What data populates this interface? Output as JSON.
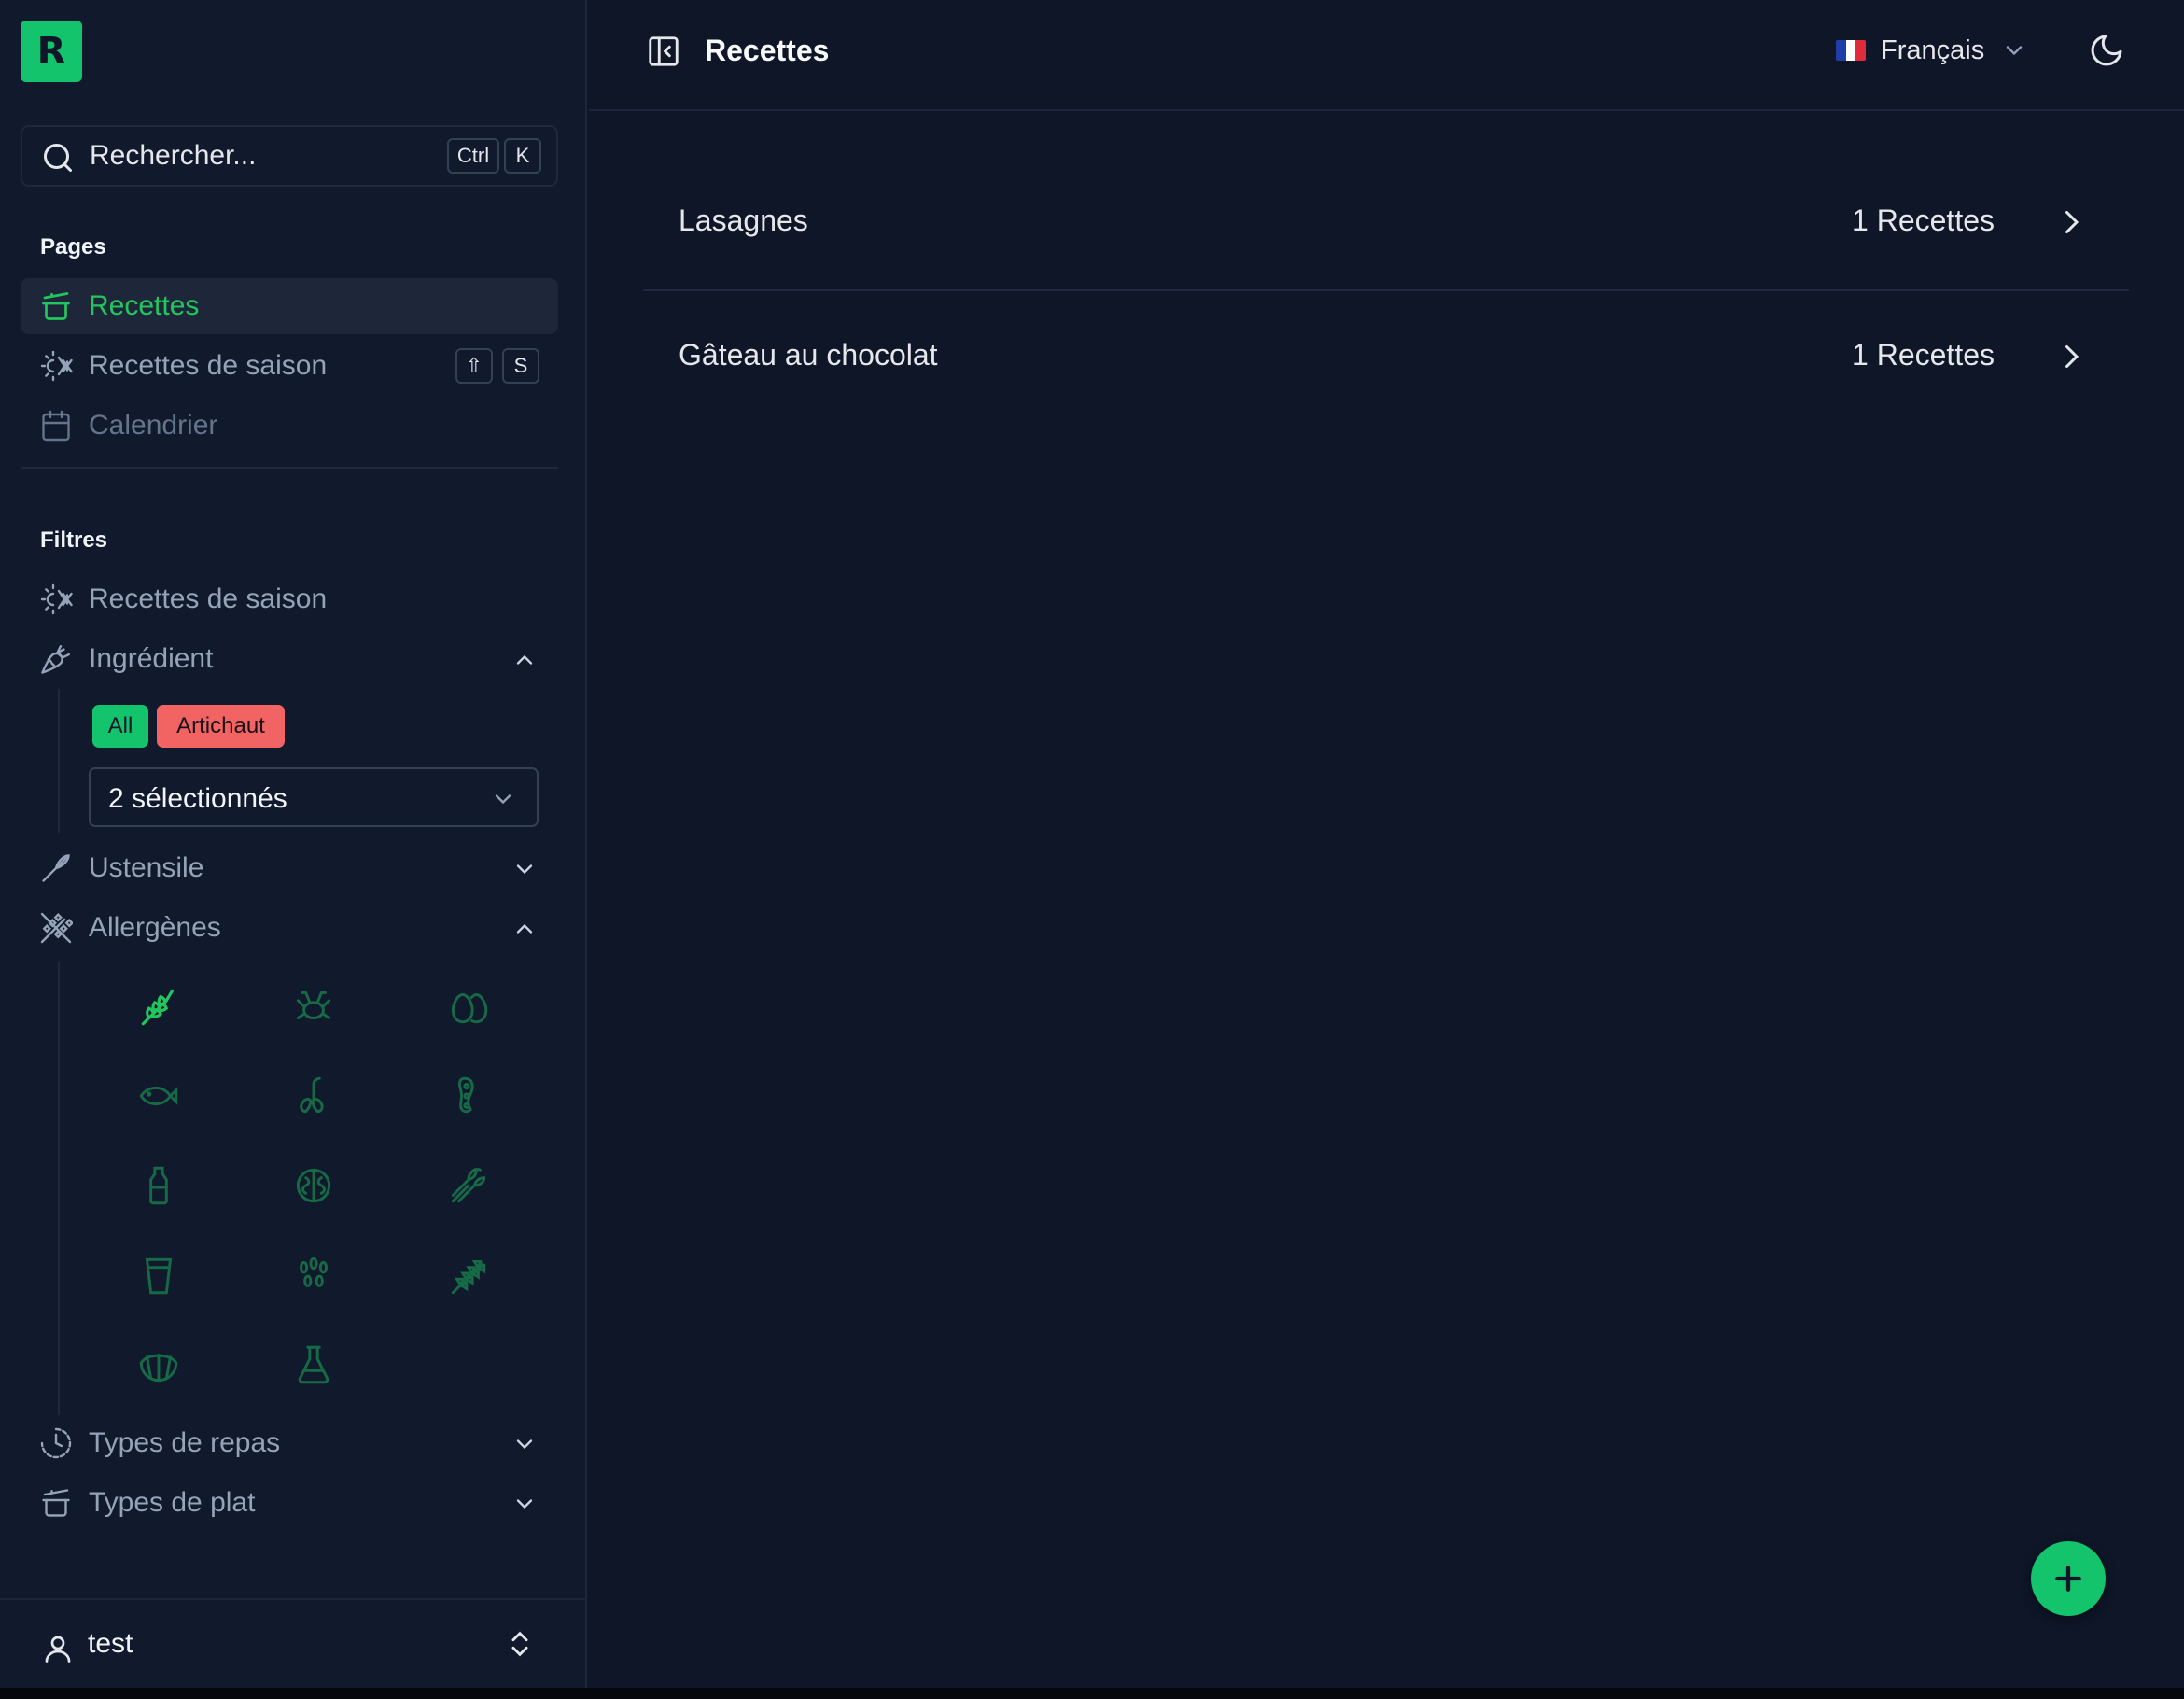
{
  "app": {
    "logo_letter": "R"
  },
  "search": {
    "placeholder": "Rechercher...",
    "shortcut": [
      "Ctrl",
      "K"
    ]
  },
  "sidebar": {
    "pages_title": "Pages",
    "pages": [
      {
        "label": "Recettes",
        "icon": "pot-icon",
        "active": true
      },
      {
        "label": "Recettes de saison",
        "icon": "sun-snowflake-icon",
        "shortcut": [
          "⇧",
          "S"
        ]
      },
      {
        "label": "Calendrier",
        "icon": "calendar-icon"
      }
    ],
    "filters_title": "Filtres",
    "filters": {
      "season": {
        "label": "Recettes de saison",
        "icon": "sun-snowflake-icon"
      },
      "ingredient": {
        "label": "Ingrédient",
        "icon": "carrot-icon",
        "expanded": true,
        "chips": [
          {
            "label": "All",
            "color": "#14c46c"
          },
          {
            "label": "Artichaut",
            "color": "#f26464"
          }
        ],
        "select_value": "2 sélectionnés"
      },
      "utensil": {
        "label": "Ustensile",
        "icon": "whisk-icon",
        "expanded": false
      },
      "allergens": {
        "label": "Allergènes",
        "icon": "wheat-off-icon",
        "expanded": true,
        "items": [
          {
            "icon": "gluten-icon",
            "active": true
          },
          {
            "icon": "crustacean-icon"
          },
          {
            "icon": "egg-icon"
          },
          {
            "icon": "fish-icon"
          },
          {
            "icon": "peanut-icon"
          },
          {
            "icon": "soy-icon"
          },
          {
            "icon": "milk-icon"
          },
          {
            "icon": "nut-icon"
          },
          {
            "icon": "celery-icon"
          },
          {
            "icon": "mustard-icon"
          },
          {
            "icon": "sesame-icon"
          },
          {
            "icon": "lupin-icon"
          },
          {
            "icon": "mollusc-icon"
          },
          {
            "icon": "sulphite-icon"
          }
        ]
      },
      "meal_types": {
        "label": "Types de repas",
        "icon": "clock-icon",
        "expanded": false
      },
      "dish_types": {
        "label": "Types de plat",
        "icon": "pot-icon",
        "expanded": false
      }
    },
    "user": {
      "name": "test"
    }
  },
  "header": {
    "title": "Recettes",
    "language": "Français"
  },
  "recipes": [
    {
      "name": "Lasagnes",
      "count": "1 Recettes"
    },
    {
      "name": "Gâteau au chocolat",
      "count": "1 Recettes"
    }
  ],
  "colors": {
    "accent": "#22c55e",
    "background": "#0e1628",
    "sidebar": "#111a2d",
    "danger": "#f26464"
  }
}
